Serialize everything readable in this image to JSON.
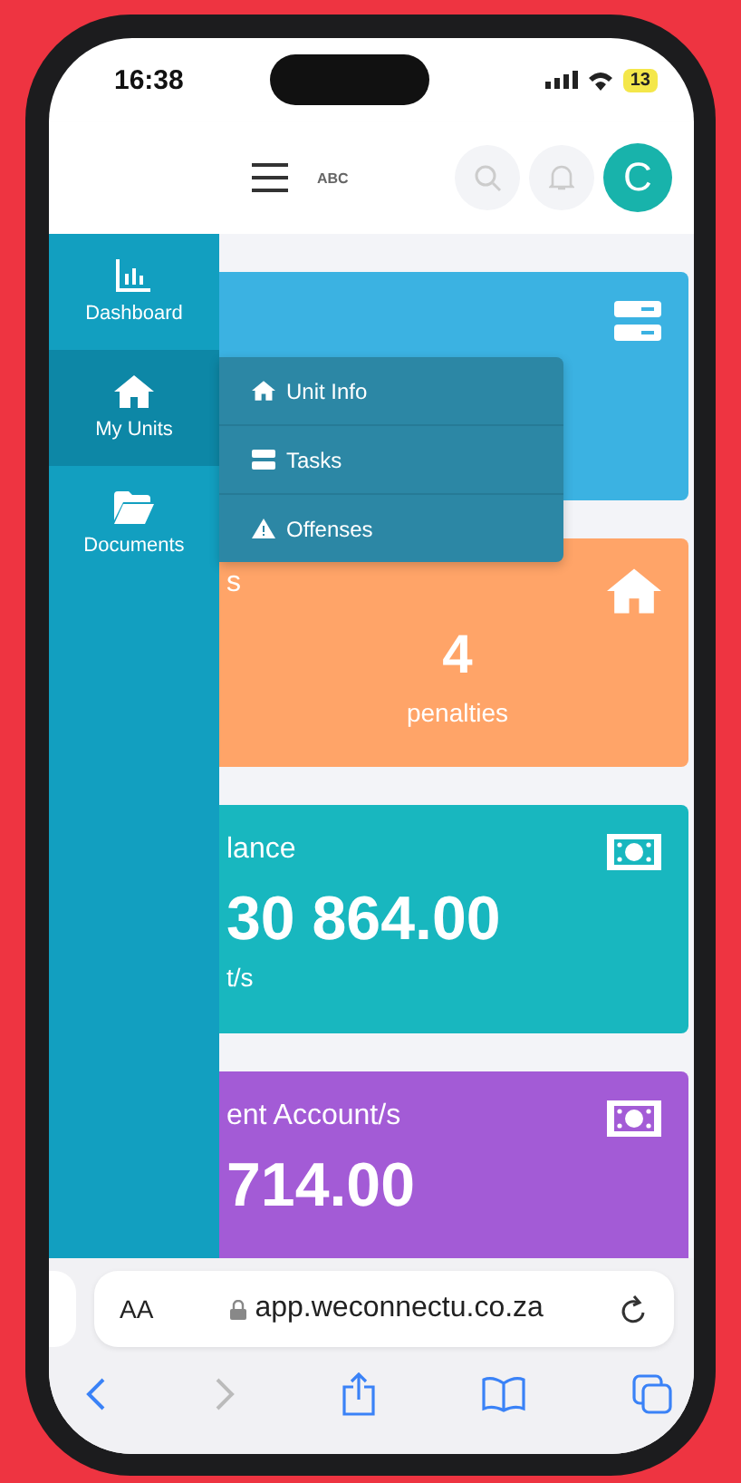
{
  "status_bar": {
    "time": "16:38",
    "battery": "13"
  },
  "header": {
    "logo": "ABC",
    "avatar": "C"
  },
  "sidebar": {
    "items": [
      {
        "label": "Dashboard",
        "selected": false
      },
      {
        "label": "My Units",
        "selected": true
      },
      {
        "label": "Documents",
        "selected": false
      }
    ]
  },
  "submenu": {
    "items": [
      {
        "label": "Unit Info"
      },
      {
        "label": "Tasks"
      },
      {
        "label": "Offenses"
      }
    ]
  },
  "cards": [
    {
      "kind": "icon-only",
      "color": "#3bb2e2"
    },
    {
      "kind": "count",
      "color": "#ffa468",
      "title": "s",
      "value": "4",
      "caption": "penalties"
    },
    {
      "kind": "amount",
      "color": "#18b7bf",
      "title": "lance",
      "value": "30 864.00",
      "caption": "t/s"
    },
    {
      "kind": "amount",
      "color": "#a35bd6",
      "title": "ent Account/s",
      "value": "714.00"
    }
  ],
  "browser": {
    "text_size": "AA",
    "url": "app.weconnectu.co.za"
  }
}
